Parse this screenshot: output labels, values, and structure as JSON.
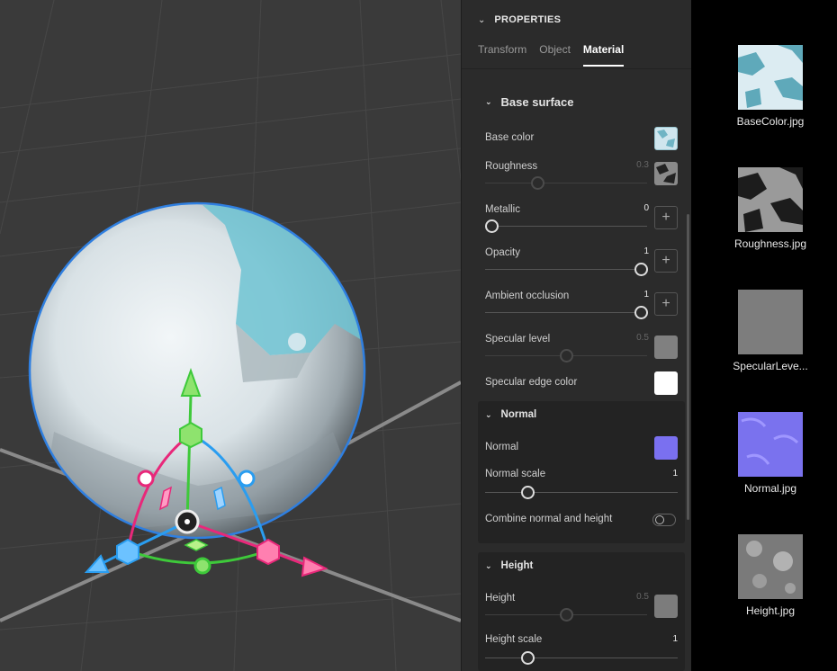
{
  "panel": {
    "header_title": "PROPERTIES",
    "tabs": [
      "Transform",
      "Object",
      "Material"
    ],
    "active_tab": "Material",
    "base_surface": {
      "title": "Base surface",
      "base_color_label": "Base color",
      "roughness_label": "Roughness",
      "roughness_value": "0.3",
      "metallic_label": "Metallic",
      "metallic_value": "0",
      "opacity_label": "Opacity",
      "opacity_value": "1",
      "ao_label": "Ambient occlusion",
      "ao_value": "1",
      "specular_level_label": "Specular level",
      "specular_level_value": "0.5",
      "specular_edge_label": "Specular edge color"
    },
    "normal": {
      "title": "Normal",
      "normal_label": "Normal",
      "scale_label": "Normal scale",
      "scale_value": "1",
      "combine_label": "Combine normal and height"
    },
    "height": {
      "title": "Height",
      "height_label": "Height",
      "height_value": "0.5",
      "scale_label": "Height scale",
      "scale_value": "1"
    },
    "plus": "+"
  },
  "assets": [
    {
      "name": "BaseColor.jpg",
      "icon": "basecolor-texture"
    },
    {
      "name": "Roughness.jpg",
      "icon": "roughness-texture"
    },
    {
      "name": "SpecularLeve...",
      "icon": "specular-texture"
    },
    {
      "name": "Normal.jpg",
      "icon": "normal-texture"
    },
    {
      "name": "Height.jpg",
      "icon": "height-texture"
    }
  ],
  "colors": {
    "axis_x": "#e8287a",
    "axis_y": "#3ec93a",
    "axis_z": "#2a9df0",
    "selection": "#2f7fe0",
    "normal_swatch": "#7a70f0"
  }
}
